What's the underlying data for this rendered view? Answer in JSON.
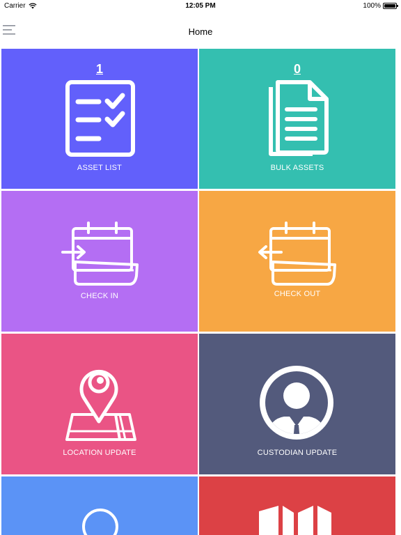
{
  "status_bar": {
    "carrier": "Carrier",
    "time": "12:05 PM",
    "battery_percent": "100%",
    "battery_level": 1.0
  },
  "nav": {
    "title": "Home",
    "menu_icon": "hamburger-menu-icon"
  },
  "tiles": [
    {
      "id": "asset-list",
      "label": "ASSET LIST",
      "count": "1",
      "color": "#6260fb",
      "icon": "checklist-icon"
    },
    {
      "id": "bulk-assets",
      "label": "BULK ASSETS",
      "count": "0",
      "color": "#34bfb0",
      "icon": "documents-icon"
    },
    {
      "id": "check-in",
      "label": "CHECK IN",
      "color": "#b46ef3",
      "icon": "calendar-arrow-in-icon"
    },
    {
      "id": "check-out",
      "label": "CHECK OUT",
      "color": "#f7a744",
      "icon": "calendar-arrow-out-icon"
    },
    {
      "id": "location-update",
      "label": "LOCATION UPDATE",
      "color": "#ea5485",
      "icon": "map-pin-icon"
    },
    {
      "id": "custodian-update",
      "label": "CUSTODIAN UPDATE",
      "color": "#535a7c",
      "icon": "user-avatar-icon"
    },
    {
      "id": "tile-7",
      "color": "#5b93f6",
      "icon": "circle-icon"
    },
    {
      "id": "tile-8",
      "color": "#dc4145",
      "icon": "folded-map-icon"
    }
  ]
}
